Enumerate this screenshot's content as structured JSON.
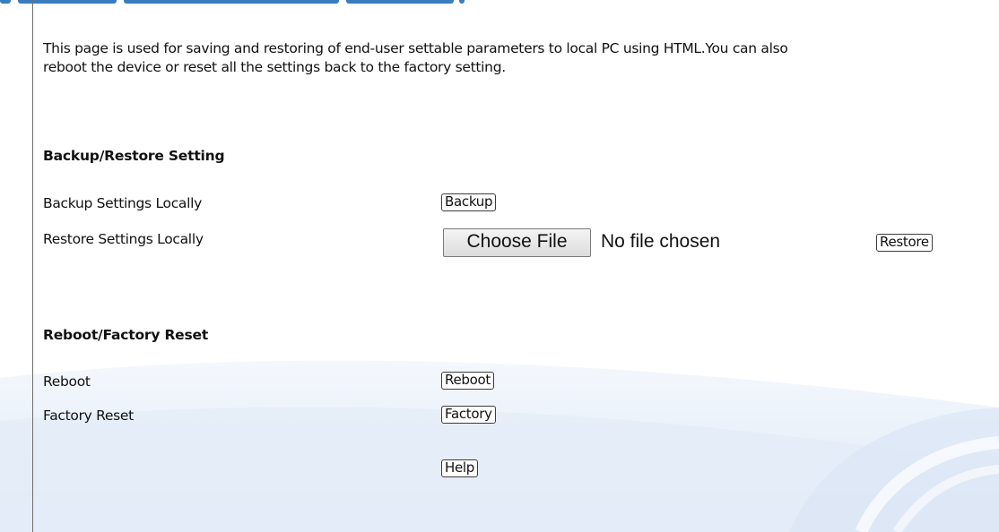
{
  "description": {
    "line1": "This page is used for saving and restoring of end-user settable parameters to local PC using HTML.You can also",
    "line2": "reboot the device or reset all the settings back to the factory setting."
  },
  "backup_restore": {
    "heading": "Backup/Restore Setting",
    "backup_label": "Backup Settings Locally",
    "backup_button": "Backup",
    "restore_label": "Restore Settings Locally",
    "choose_file_button": "Choose File",
    "file_status": "No file chosen",
    "restore_button": "Restore"
  },
  "reboot_reset": {
    "heading": "Reboot/Factory Reset",
    "reboot_label": "Reboot",
    "reboot_button": "Reboot",
    "factory_label": "Factory Reset",
    "factory_button": "Factory"
  },
  "help_button": "Help",
  "colors": {
    "header_accent": "#3a7cc0",
    "background_swoosh": "#e6eef9",
    "border": "#6e6e6e"
  }
}
